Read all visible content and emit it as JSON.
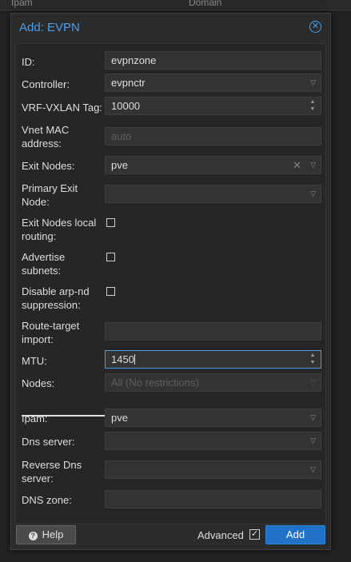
{
  "background": {
    "col_ipam": "Ipam",
    "col_domain": "Domain"
  },
  "dialog": {
    "title": "Add: EVPN",
    "close_icon": "close-icon"
  },
  "form": {
    "id": {
      "label": "ID:",
      "value": "evpnzone"
    },
    "controller": {
      "label": "Controller:",
      "value": "evpnctr"
    },
    "vrf_vxlan_tag": {
      "label": "VRF-VXLAN Tag:",
      "value": "10000"
    },
    "vnet_mac": {
      "label_line1": "Vnet MAC",
      "label_line2": "address:",
      "placeholder": "auto"
    },
    "exit_nodes": {
      "label": "Exit Nodes:",
      "value": "pve"
    },
    "primary_exit_node": {
      "label_line1": "Primary Exit",
      "label_line2": "Node:",
      "value": ""
    },
    "exit_nodes_local_routing": {
      "label_line1": "Exit Nodes local",
      "label_line2": "routing:",
      "checked": false
    },
    "advertise_subnets": {
      "label_line1": "Advertise",
      "label_line2": "subnets:",
      "checked": false
    },
    "disable_arp_nd": {
      "label_line1": "Disable arp-nd",
      "label_line2": "suppression:",
      "checked": false
    },
    "route_target_import": {
      "label_line1": "Route-target",
      "label_line2": "import:",
      "value": ""
    },
    "mtu": {
      "label": "MTU:",
      "value": "1450"
    },
    "nodes": {
      "label": "Nodes:",
      "value": "All (No restrictions)"
    },
    "ipam": {
      "label": "Ipam:",
      "value": "pve"
    },
    "dns_server": {
      "label": "Dns server:",
      "value": ""
    },
    "reverse_dns_server": {
      "label_line1": "Reverse Dns",
      "label_line2": "server:",
      "value": ""
    },
    "dns_zone": {
      "label": "DNS zone:",
      "value": ""
    }
  },
  "footer": {
    "help_label": "Help",
    "advanced_label": "Advanced",
    "advanced_checked": true,
    "add_label": "Add"
  },
  "colors": {
    "accent": "#4c9fe4",
    "primary_button": "#1f72c6"
  }
}
